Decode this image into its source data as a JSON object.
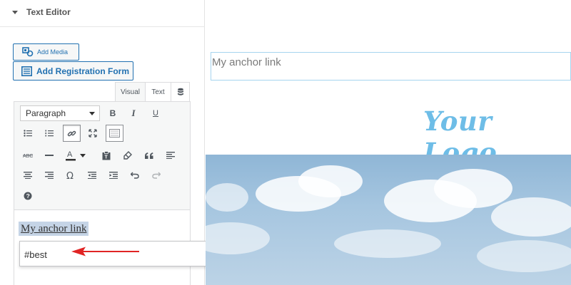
{
  "panel": {
    "section_title": "Text Editor",
    "add_media_label": "Add Media",
    "add_form_label": "Add Registration Form",
    "tabs": {
      "visual": "Visual",
      "text": "Text"
    },
    "format_select": "Paragraph"
  },
  "editor": {
    "selected_text": "My anchor link",
    "link_url": "#best"
  },
  "preview": {
    "anchor_text": "My anchor link",
    "logo_text": "Your Logo"
  },
  "colors": {
    "accent": "#2271b1",
    "logo": "#6ebde7",
    "selection": "#c5d4e6",
    "arrow": "#e02424"
  }
}
